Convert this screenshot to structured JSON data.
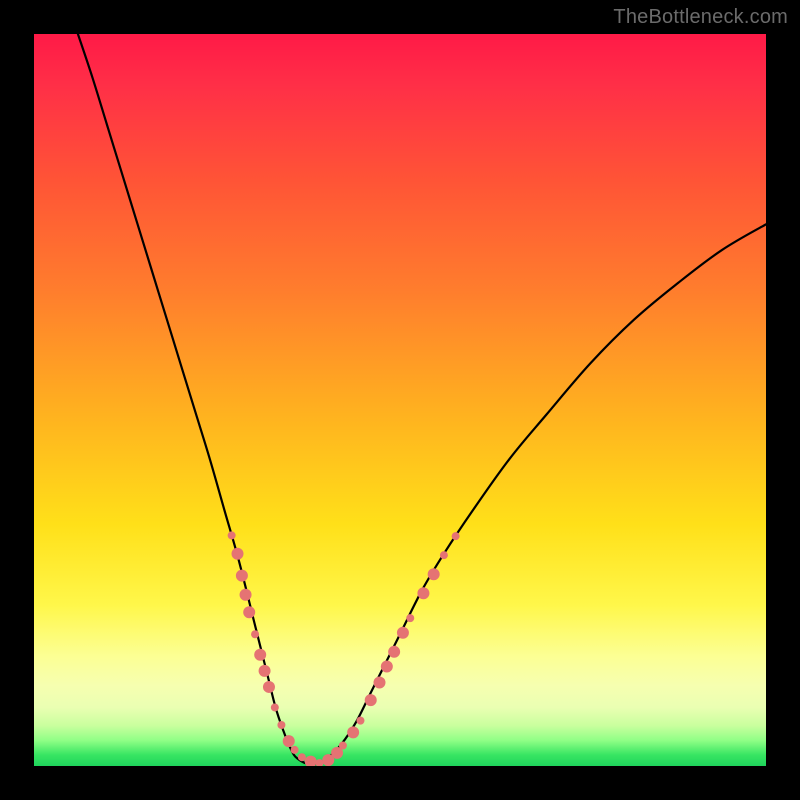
{
  "watermark": "TheBottleneck.com",
  "chart_data": {
    "type": "line",
    "title": "",
    "xlabel": "",
    "ylabel": "",
    "xlim": [
      0,
      100
    ],
    "ylim": [
      0,
      100
    ],
    "series": [
      {
        "name": "bottleneck-curve",
        "x": [
          6,
          8,
          10,
          12,
          14,
          16,
          18,
          20,
          22,
          24,
          26,
          28,
          30,
          31,
          32,
          33,
          34,
          35,
          36,
          38,
          40,
          42,
          44,
          46,
          48,
          50,
          53,
          56,
          60,
          65,
          70,
          76,
          82,
          88,
          94,
          100
        ],
        "y": [
          100,
          94,
          87.5,
          81,
          74.5,
          68,
          61.5,
          55,
          48.5,
          42,
          35,
          28,
          20,
          16,
          12,
          8,
          5,
          2.5,
          1,
          0.2,
          1,
          3,
          6,
          10,
          14,
          18,
          24,
          29,
          35,
          42,
          48,
          55,
          61,
          66,
          70.5,
          74
        ]
      }
    ],
    "markers": {
      "name": "highlighted-points",
      "color": "#e57373",
      "points": [
        {
          "x": 27.0,
          "y": 31.5,
          "r": 4
        },
        {
          "x": 27.8,
          "y": 29.0,
          "r": 6
        },
        {
          "x": 28.4,
          "y": 26.0,
          "r": 6
        },
        {
          "x": 28.9,
          "y": 23.4,
          "r": 6
        },
        {
          "x": 29.4,
          "y": 21.0,
          "r": 6
        },
        {
          "x": 30.2,
          "y": 18.0,
          "r": 4
        },
        {
          "x": 30.9,
          "y": 15.2,
          "r": 6
        },
        {
          "x": 31.5,
          "y": 13.0,
          "r": 6
        },
        {
          "x": 32.1,
          "y": 10.8,
          "r": 6
        },
        {
          "x": 32.9,
          "y": 8.0,
          "r": 4
        },
        {
          "x": 33.8,
          "y": 5.6,
          "r": 4
        },
        {
          "x": 34.8,
          "y": 3.4,
          "r": 6
        },
        {
          "x": 35.6,
          "y": 2.2,
          "r": 4
        },
        {
          "x": 36.6,
          "y": 1.2,
          "r": 4
        },
        {
          "x": 37.8,
          "y": 0.6,
          "r": 6
        },
        {
          "x": 39.0,
          "y": 0.4,
          "r": 4
        },
        {
          "x": 40.2,
          "y": 0.8,
          "r": 6
        },
        {
          "x": 41.4,
          "y": 1.8,
          "r": 6
        },
        {
          "x": 42.2,
          "y": 2.8,
          "r": 4
        },
        {
          "x": 43.6,
          "y": 4.6,
          "r": 6
        },
        {
          "x": 44.6,
          "y": 6.2,
          "r": 4
        },
        {
          "x": 46.0,
          "y": 9.0,
          "r": 6
        },
        {
          "x": 47.2,
          "y": 11.4,
          "r": 6
        },
        {
          "x": 48.2,
          "y": 13.6,
          "r": 6
        },
        {
          "x": 49.2,
          "y": 15.6,
          "r": 6
        },
        {
          "x": 50.4,
          "y": 18.2,
          "r": 6
        },
        {
          "x": 51.4,
          "y": 20.2,
          "r": 4
        },
        {
          "x": 53.2,
          "y": 23.6,
          "r": 6
        },
        {
          "x": 54.6,
          "y": 26.2,
          "r": 6
        },
        {
          "x": 56.0,
          "y": 28.8,
          "r": 4
        },
        {
          "x": 57.6,
          "y": 31.4,
          "r": 4
        }
      ]
    },
    "background_gradient": {
      "top": "#ff1a47",
      "mid": "#ffe019",
      "bottom": "#1fd45c"
    }
  }
}
